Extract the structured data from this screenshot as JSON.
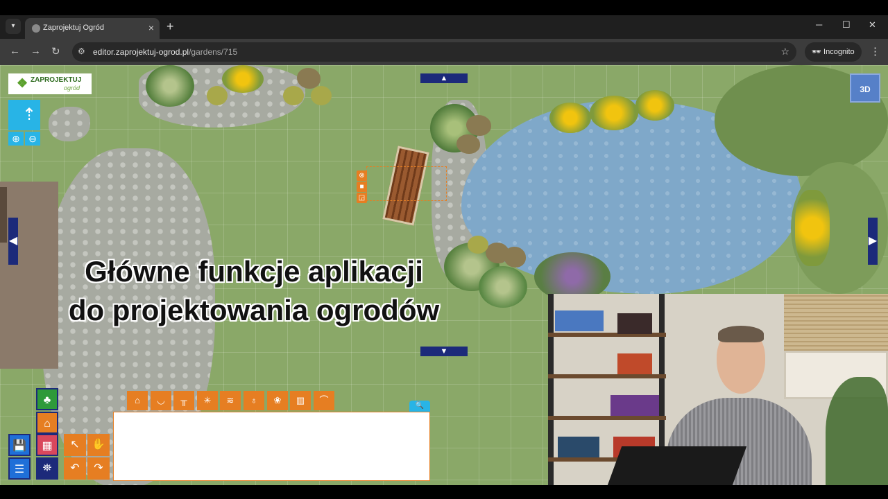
{
  "browser": {
    "tab_title": "Zaprojektuj Ogród",
    "url_host": "editor.zaprojektuj-ogrod.pl",
    "url_path": "/gardens/715",
    "incognito_label": "Incognito"
  },
  "app": {
    "logo_text": "ZAPROJEKTUJ",
    "logo_sub": "ogród",
    "btn_3d": "3D",
    "overlay_line1": "Główne funkcje aplikacji",
    "overlay_line2": "do projektowania ogrodów"
  },
  "icons": {
    "categories": [
      "pavilion-icon",
      "pot-icon",
      "bench-icon",
      "palm-icon",
      "pond-icon",
      "lamp-icon",
      "stones-icon",
      "fence-icon",
      "slide-icon"
    ],
    "sidebar": [
      "tree-icon",
      "house-icon",
      "wall-icon",
      "save-icon",
      "menu-icon",
      "map-icon"
    ],
    "tools": [
      "select-arrow-icon",
      "hand-icon",
      "undo-icon",
      "redo-icon"
    ]
  },
  "colors": {
    "accent_orange": "#e67e22",
    "accent_blue": "#28b4e6",
    "nav_blue": "#1c2a7a",
    "btn_3d": "#5680c8"
  }
}
